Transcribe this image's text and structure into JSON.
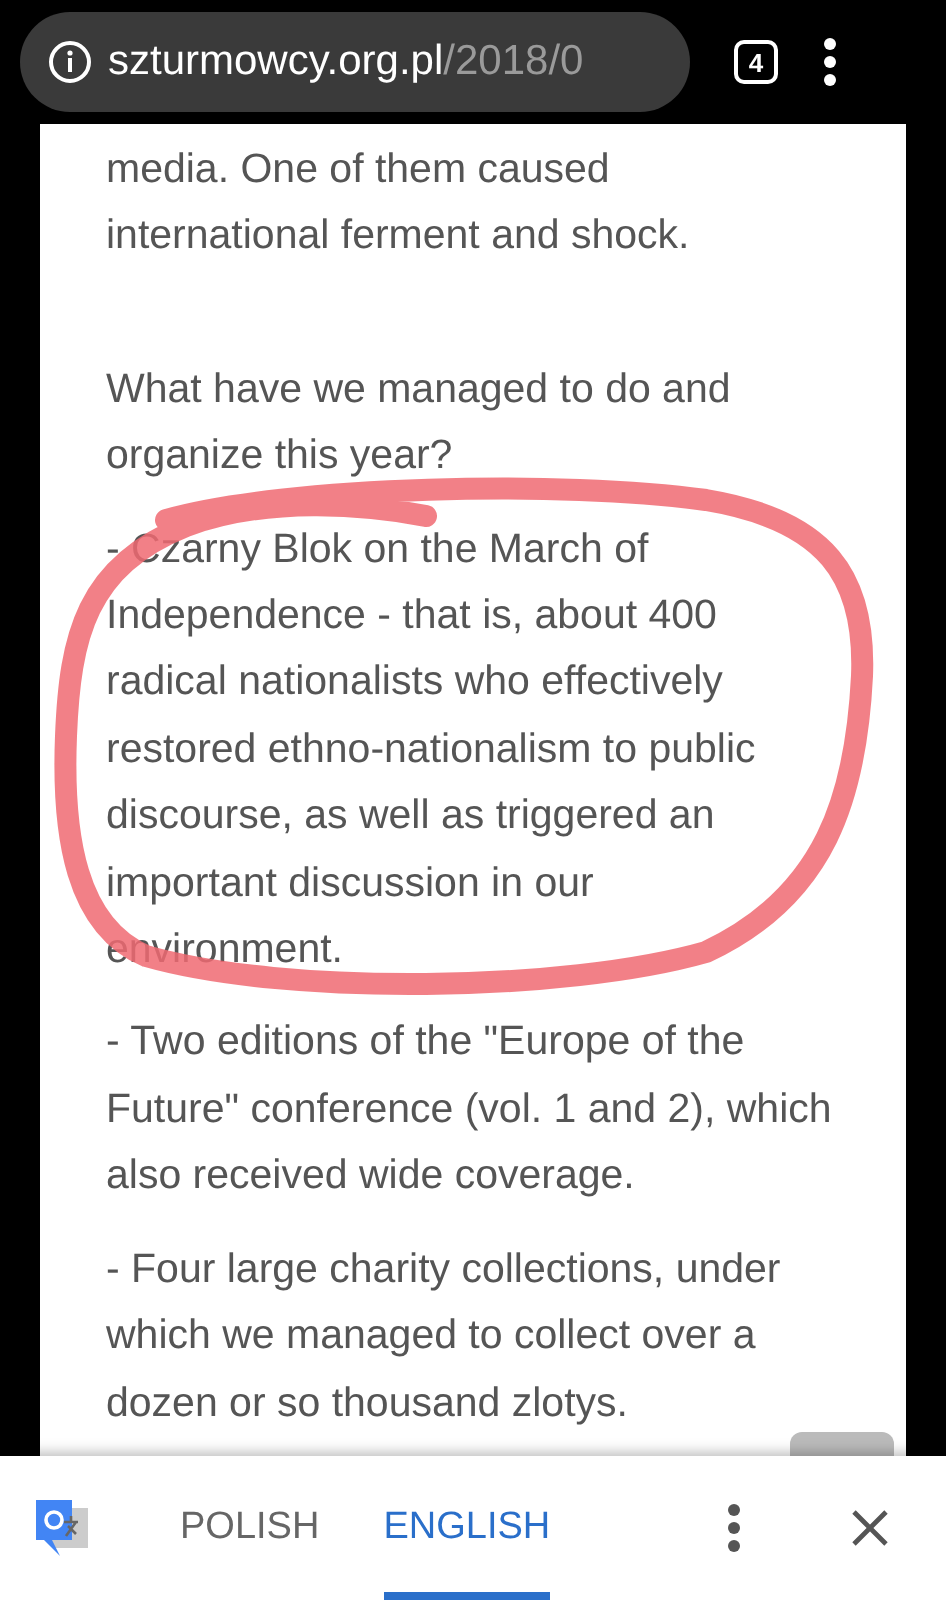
{
  "address_bar": {
    "domain": "szturmowcy.org.pl",
    "path": "/2018/0",
    "tab_count": "4"
  },
  "article": {
    "paragraphs": [
      {
        "lines": [
          "media. One of them caused",
          "international ferment and shock."
        ]
      },
      {
        "lines": [
          "What have we managed to do and",
          "organize this year?"
        ]
      },
      {
        "lines": [
          "- Czarny Blok on the March of",
          "Independence - that is, about 400",
          "radical nationalists who effectively",
          "restored ethno-nationalism to public",
          "discourse, as well as triggered an",
          "important discussion in our",
          "environment."
        ],
        "circled": true
      },
      {
        "lines": [
          "- Two editions of the \"Europe of the",
          "Future\" conference (vol. 1 and 2), which",
          "also received wide coverage."
        ]
      },
      {
        "lines": [
          "- Four large charity collections, under",
          "which we managed to collect over a",
          "dozen or so thousand zlotys."
        ]
      }
    ]
  },
  "translate_bar": {
    "languages": [
      {
        "label": "POLISH",
        "selected": false
      },
      {
        "label": "ENGLISH",
        "selected": true
      }
    ]
  }
}
